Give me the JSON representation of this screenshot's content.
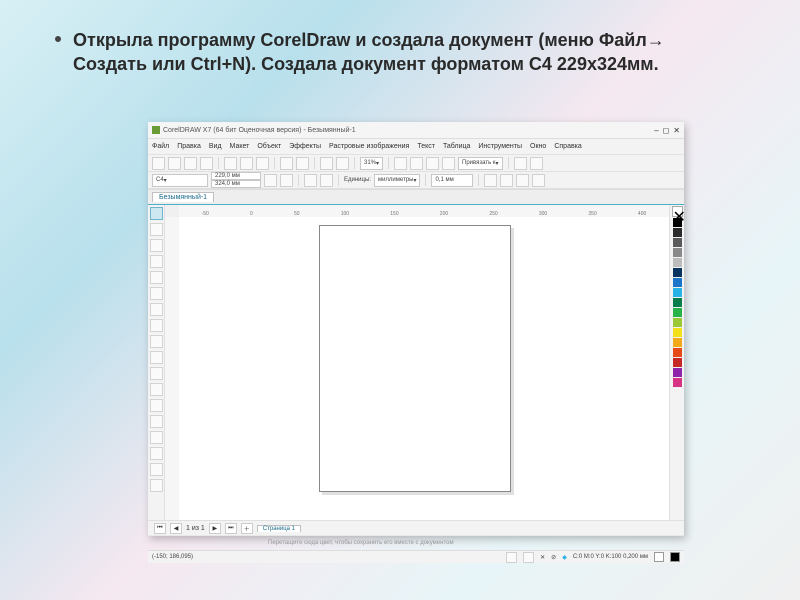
{
  "slide": {
    "caption": "Открыла программу CorelDraw и создала документ (меню Файл→ Создать или Ctrl+N). Создала документ форматом С4 229х324мм."
  },
  "app": {
    "title": "CorelDRAW X7 (64 бит Оценочная версия) - Безымянный-1",
    "win_min": "–",
    "win_max": "◻",
    "win_close": "✕"
  },
  "menu": {
    "items": [
      "Файл",
      "Правка",
      "Вид",
      "Макет",
      "Объект",
      "Эффекты",
      "Растровые изображения",
      "Текст",
      "Таблица",
      "Инструменты",
      "Окно",
      "Справка"
    ]
  },
  "toolbar": {
    "zoom": "31%",
    "snap_label": "Привязать к"
  },
  "propbar": {
    "preset": "C4",
    "width": "229,0 мм",
    "height": "324,0 мм",
    "units_label": "Единицы:",
    "units_value": "миллиметры",
    "nudge": "0,1 мм"
  },
  "tab": {
    "label": "Безымянный-1"
  },
  "ruler": {
    "ticks": [
      "-50",
      "0",
      "50",
      "100",
      "150",
      "200",
      "250",
      "300",
      "350",
      "400"
    ]
  },
  "palette": {
    "colors": [
      "#ffffff",
      "#000000",
      "#2b2b2b",
      "#5a5a5a",
      "#8a8a8a",
      "#bcbcbc",
      "#08335e",
      "#1a74c7",
      "#29b2e6",
      "#0a7d4c",
      "#27b24a",
      "#9ac836",
      "#f2e11a",
      "#f2a91a",
      "#e64a19",
      "#c62828",
      "#8e24aa",
      "#d63384"
    ]
  },
  "pagenav": {
    "counter": "1 из 1",
    "page_tab": "Страница 1"
  },
  "hint": "Перетащите сюда цвет, чтобы сохранить его вместе с документом",
  "status": {
    "left": "(-150; 186,095)",
    "cmyk": "C:0 M:0 Y:0 K:100  0,200 мм"
  }
}
